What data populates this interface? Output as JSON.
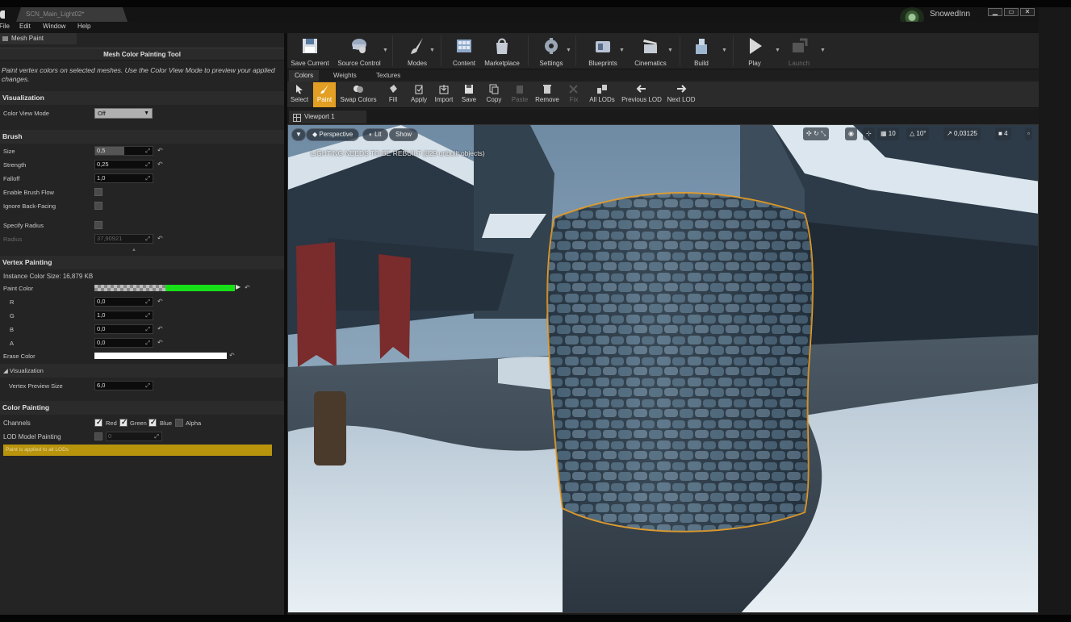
{
  "titlebar": {
    "doc_tab": "SCN_Main_Light02*",
    "user": "SnowedInn",
    "win": [
      "▁",
      "▭",
      "✕"
    ]
  },
  "menu": [
    "File",
    "Edit",
    "Window",
    "Help"
  ],
  "left": {
    "tab": "Mesh Paint",
    "title": "Mesh Color Painting Tool",
    "description": "Paint vertex colors on selected meshes.  Use the Color View Mode to preview your applied changes.",
    "visualization": {
      "header": "Visualization",
      "color_view_mode_label": "Color View Mode",
      "color_view_mode": "Off"
    },
    "brush": {
      "header": "Brush",
      "size_label": "Size",
      "size": "0,5",
      "strength_label": "Strength",
      "strength": "0,25",
      "falloff_label": "Falloff",
      "falloff": "1,0",
      "brush_flow_label": "Enable Brush Flow",
      "ignore_back_label": "Ignore Back-Facing",
      "specify_radius_label": "Specify Radius",
      "radius_label": "Radius",
      "radius": "37,90921"
    },
    "vertex": {
      "header": "Vertex Painting",
      "instance_size": "Instance Color Size: 16,879 KB",
      "paint_color_label": "Paint Color",
      "paint_color_hex": "#18e018",
      "r_label": "R",
      "r": "0,0",
      "g_label": "G",
      "g": "1,0",
      "b_label": "B",
      "b": "0,0",
      "a_label": "A",
      "a": "0,0",
      "erase_color_label": "Erase Color",
      "sub_vis": "Visualization",
      "preview_label": "Vertex Preview Size",
      "preview": "6,0"
    },
    "color_painting": {
      "header": "Color Painting",
      "channels_label": "Channels",
      "red": "Red",
      "green": "Green",
      "blue": "Blue",
      "alpha": "Alpha",
      "lod_label": "LOD Model Painting",
      "lod_value": "0",
      "banner": "Paint is applied to all LODs"
    }
  },
  "toolbar": [
    {
      "label": "Save Current",
      "icon": "save-icon"
    },
    {
      "label": "Source Control",
      "icon": "source-control-icon"
    },
    {
      "label": "Modes",
      "icon": "brush-icon"
    },
    {
      "label": "Content",
      "icon": "content-icon"
    },
    {
      "label": "Marketplace",
      "icon": "marketplace-icon"
    },
    {
      "label": "Settings",
      "icon": "gear-icon"
    },
    {
      "label": "Blueprints",
      "icon": "blueprint-icon"
    },
    {
      "label": "Cinematics",
      "icon": "clapper-icon"
    },
    {
      "label": "Build",
      "icon": "build-icon"
    },
    {
      "label": "Play",
      "icon": "play-icon"
    },
    {
      "label": "Launch",
      "icon": "launch-icon"
    }
  ],
  "mode_tabs": [
    "Colors",
    "Weights",
    "Textures"
  ],
  "paint_tools": [
    "Select",
    "Paint",
    "Swap Colors",
    "Fill",
    "Apply",
    "Import",
    "Save",
    "Copy",
    "Paste",
    "Remove",
    "Fix",
    "All LODs",
    "Previous LOD",
    "Next LOD"
  ],
  "viewport": {
    "tab": "Viewport 1",
    "perspective": "Perspective",
    "lit": "Lit",
    "show": "Show",
    "warning": "LIGHTING NEEDS TO BE REBUILT (829 unbuilt objects)",
    "grid": "10",
    "rot": "10°",
    "scale": "0,03125",
    "cams": "4"
  },
  "colors": {
    "accent": "#e29f23",
    "paint": "#18e018",
    "selection": "#f0a020"
  }
}
